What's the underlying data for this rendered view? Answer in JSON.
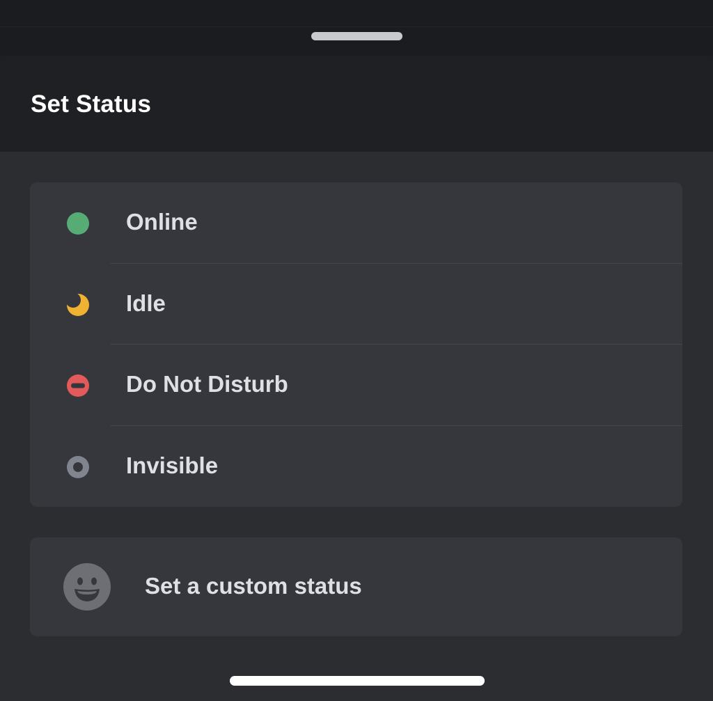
{
  "sheet": {
    "title": "Set Status"
  },
  "statuses": [
    {
      "label": "Online",
      "icon": "online-dot-icon",
      "color": "#43a25a"
    },
    {
      "label": "Idle",
      "icon": "idle-moon-icon",
      "color": "#f0b232"
    },
    {
      "label": "Do Not Disturb",
      "icon": "dnd-icon",
      "color": "#f23f43"
    },
    {
      "label": "Invisible",
      "icon": "invisible-ring-icon",
      "color": "#80848e"
    }
  ],
  "custom_status": {
    "label": "Set a custom status",
    "icon": "smile-emoji-icon",
    "color": "#707277"
  },
  "colors": {
    "background": "#1e1f22",
    "sheet": "#2c2d31",
    "card": "#36373c",
    "text": "#dfe0e3"
  }
}
